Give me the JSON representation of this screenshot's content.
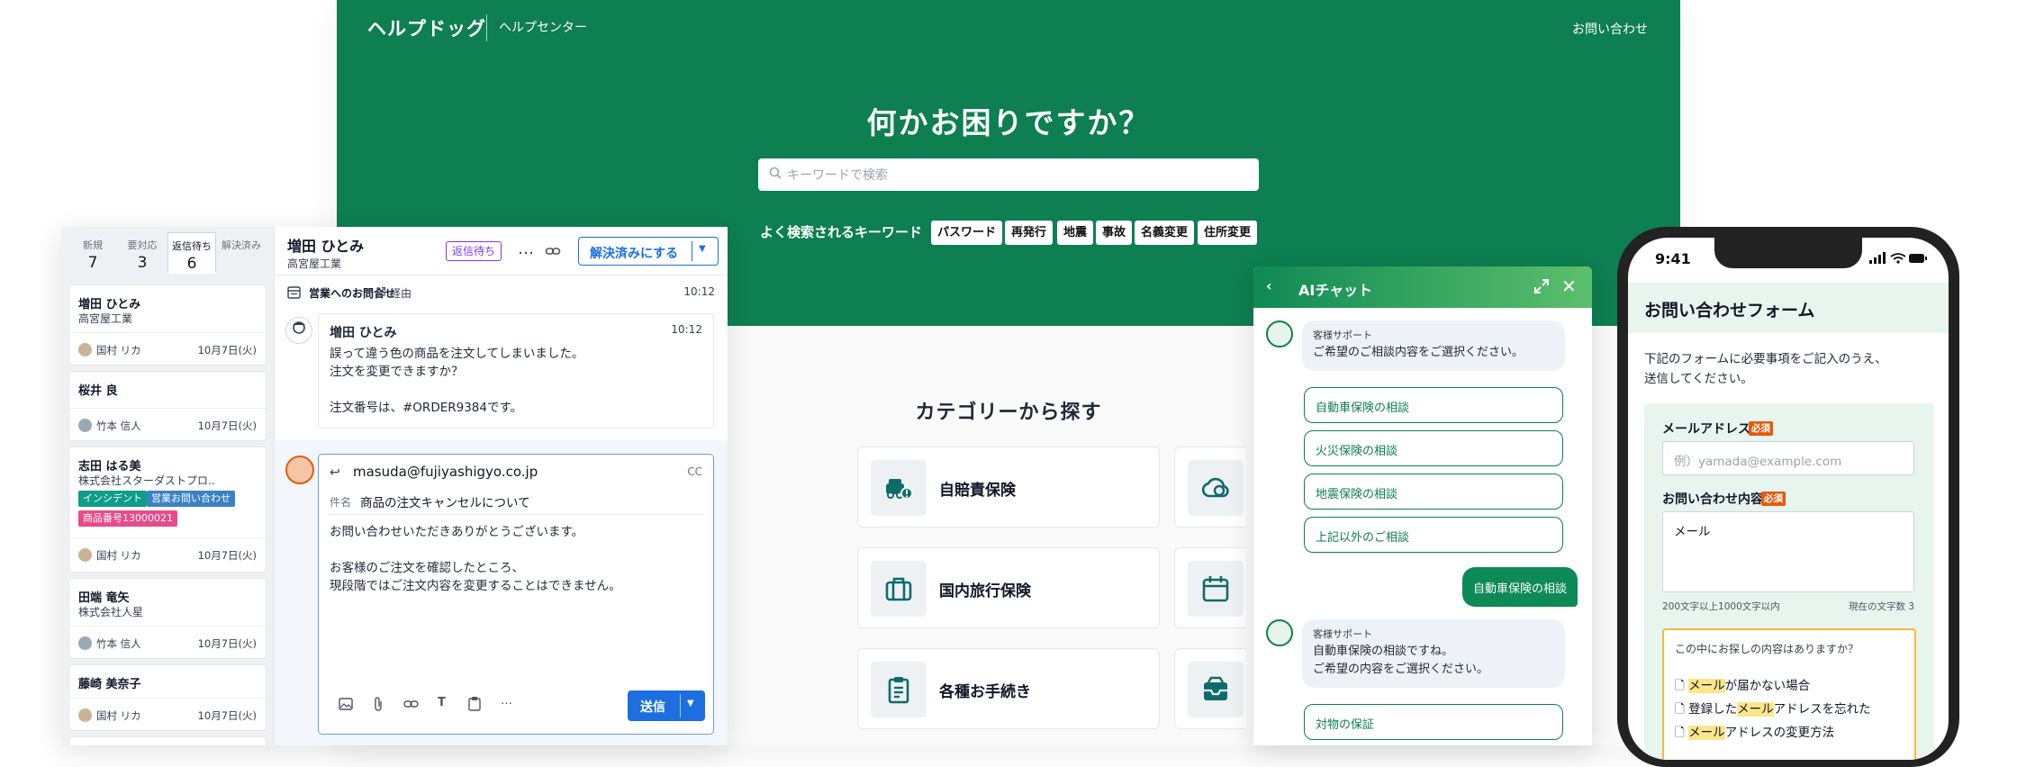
{
  "help_center": {
    "logo": "ヘルプドッグ",
    "subtitle": "ヘルプセンター",
    "contact": "お問い合わせ",
    "hero_title": "何かお困りですか？",
    "search_placeholder": "キーワードで検索",
    "keywords_label": "よく検索されるキーワード",
    "keywords": [
      "パスワード",
      "再発行",
      "地震",
      "事故",
      "名義変更",
      "住所変更"
    ],
    "category_title": "カテゴリーから探す",
    "categories": [
      {
        "label": "自賠責保険",
        "icon": "car-icon"
      },
      {
        "label": "国内旅行保険",
        "icon": "suitcase-icon"
      },
      {
        "label": "各種お手続き",
        "icon": "clipboard-icon"
      }
    ],
    "right_category_icons": [
      "cloud-icon",
      "calendar-icon",
      "inbox-icon"
    ],
    "brand_color": "#0d7f50"
  },
  "inbox": {
    "tabs": [
      {
        "label": "新規",
        "count": "7"
      },
      {
        "label": "要対応",
        "count": "3"
      },
      {
        "label": "返信待ち",
        "count": "6"
      },
      {
        "label": "解決済み",
        "count": ""
      }
    ],
    "cards": [
      {
        "name": "増田 ひとみ",
        "company": "高宮屋工業",
        "agent": "国村 リカ",
        "date": "10月7日(火)"
      },
      {
        "name": "桜井 良",
        "company": "",
        "agent": "竹本 信人",
        "date": "10月7日(火)"
      },
      {
        "name": "志田 はる美",
        "company": "株式会社スターダストプロ..",
        "tags": [
          "インシデント",
          "営業お問い合わせ",
          "商品番号13000021"
        ],
        "agent": "国村 リカ",
        "date": "10月7日(火)"
      },
      {
        "name": "田端 竜矢",
        "company": "株式会社人星",
        "agent": "竹本 信人",
        "date": "10月7日(火)"
      },
      {
        "name": "藤崎 美奈子",
        "company": "",
        "agent": "国村 リカ",
        "date": "10月7日(火)"
      }
    ],
    "tag_colors": [
      "#0f9d8a",
      "#3b82c4",
      "#e94b8a"
    ],
    "conversation": {
      "name": "増田 ひとみ",
      "company": "高宮屋工業",
      "status_badge": "返信待ち",
      "more": "…",
      "resolve_button": "解決済みにする",
      "source": "営業へのお問合せ",
      "via": "経由",
      "source_time": "10:12",
      "message": {
        "sender": "増田 ひとみ",
        "time": "10:12",
        "body": "誤って違う色の商品を注文してしまいました。\n注文を変更できますか？\n\n注文番号は、#ORDER9384です。"
      },
      "reply": {
        "to": "masuda@fujiyashigyo.co.jp",
        "cc": "CC",
        "subject_label": "件名",
        "subject": "商品の注文キャンセルについて",
        "body": "お問い合わせいただきありがとうございます。\n\nお客様のご注文を確認したところ、\n現段階ではご注文内容を変更することはできません。",
        "send": "送信",
        "toolbar_text_glyph": "T",
        "toolbar_more": "…"
      }
    }
  },
  "chat": {
    "title": "AIチャット",
    "bot_name": "客様サポート",
    "greeting": "ご希望のご相談内容をご選択ください。",
    "options": [
      "自動車保険の相談",
      "火災保険の相談",
      "地震保険の相談",
      "上記以外のご相談"
    ],
    "user_choice": "自動車保険の相談",
    "reply_text": "自動車保険の相談ですね。\nご希望の内容をご選択ください。",
    "followup_option": "対物の保証"
  },
  "phone": {
    "time": "9:41",
    "title": "お問い合わせフォーム",
    "description": "下記のフォームに必要事項をご記入のうえ、\n送信してください。",
    "email_label": "メールアドレス",
    "required": "必須",
    "email_placeholder": "例）yamada@example.com",
    "content_label": "お問い合わせ内容",
    "content_value": "メール",
    "char_limit": "200文字以上1000文字以内",
    "char_count": "現在の文字数 3",
    "suggest_question": "この中にお探しの内容はありますか？",
    "suggestions": [
      {
        "pre": "",
        "hl": "メール",
        "post": "が届かない場合"
      },
      {
        "pre": "登録した",
        "hl": "メール",
        "post": "アドレスを忘れた"
      },
      {
        "pre": "",
        "hl": "メール",
        "post": "アドレスの変更方法"
      }
    ]
  }
}
